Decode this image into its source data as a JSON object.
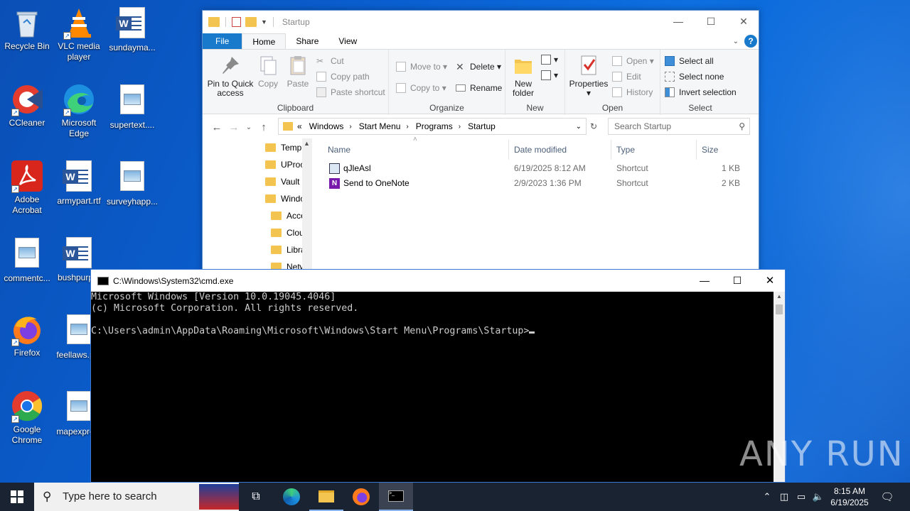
{
  "desktop": {
    "icons": [
      {
        "label": "Recycle Bin"
      },
      {
        "label": "VLC media player"
      },
      {
        "label": "sundayma..."
      },
      {
        "label": "CCleaner"
      },
      {
        "label": "Microsoft Edge"
      },
      {
        "label": "supertext...."
      },
      {
        "label": "Adobe Acrobat"
      },
      {
        "label": "armypart.rtf"
      },
      {
        "label": "surveyhapp..."
      },
      {
        "label": "commentc..."
      },
      {
        "label": "bushpurp..."
      },
      {
        "label": "Firefox"
      },
      {
        "label": "feellaws.p..."
      },
      {
        "label": "Google Chrome"
      },
      {
        "label": "mapexpre..."
      }
    ],
    "watermark": "ANY RUN"
  },
  "explorer": {
    "title": "Startup",
    "tabs": {
      "file": "File",
      "home": "Home",
      "share": "Share",
      "view": "View"
    },
    "ribbon": {
      "clipboard": {
        "label": "Clipboard",
        "pin": "Pin to Quick access",
        "copy": "Copy",
        "paste": "Paste",
        "cut": "Cut",
        "copy_path": "Copy path",
        "paste_shortcut": "Paste shortcut"
      },
      "organize": {
        "label": "Organize",
        "move_to": "Move to",
        "copy_to": "Copy to",
        "delete": "Delete",
        "rename": "Rename"
      },
      "new": {
        "label": "New",
        "new_folder": "New folder"
      },
      "open": {
        "label": "Open",
        "properties": "Properties",
        "open": "Open",
        "edit": "Edit",
        "history": "History"
      },
      "select": {
        "label": "Select",
        "select_all": "Select all",
        "select_none": "Select none",
        "invert": "Invert selection"
      }
    },
    "address": {
      "overflow": "«",
      "crumbs": [
        "Windows",
        "Start Menu",
        "Programs",
        "Startup"
      ]
    },
    "search_placeholder": "Search Startup",
    "nav_items": [
      "Temp",
      "UProc",
      "Vault",
      "Windo",
      "Acce",
      "Clou",
      "Libra",
      "Netw"
    ],
    "columns": {
      "name": "Name",
      "date": "Date modified",
      "type": "Type",
      "size": "Size"
    },
    "files": [
      {
        "name": "qJleAsl",
        "date": "6/19/2025 8:12 AM",
        "type": "Shortcut",
        "size": "1 KB"
      },
      {
        "name": "Send to OneNote",
        "date": "2/9/2023 1:36 PM",
        "type": "Shortcut",
        "size": "2 KB"
      }
    ]
  },
  "cmd": {
    "title": "C:\\Windows\\System32\\cmd.exe",
    "lines": [
      "Microsoft Windows [Version 10.0.19045.4046]",
      "(c) Microsoft Corporation. All rights reserved.",
      "",
      "C:\\Users\\admin\\AppData\\Roaming\\Microsoft\\Windows\\Start Menu\\Programs\\Startup>"
    ]
  },
  "taskbar": {
    "search_placeholder": "Type here to search",
    "time": "8:15 AM",
    "date": "6/19/2025"
  }
}
